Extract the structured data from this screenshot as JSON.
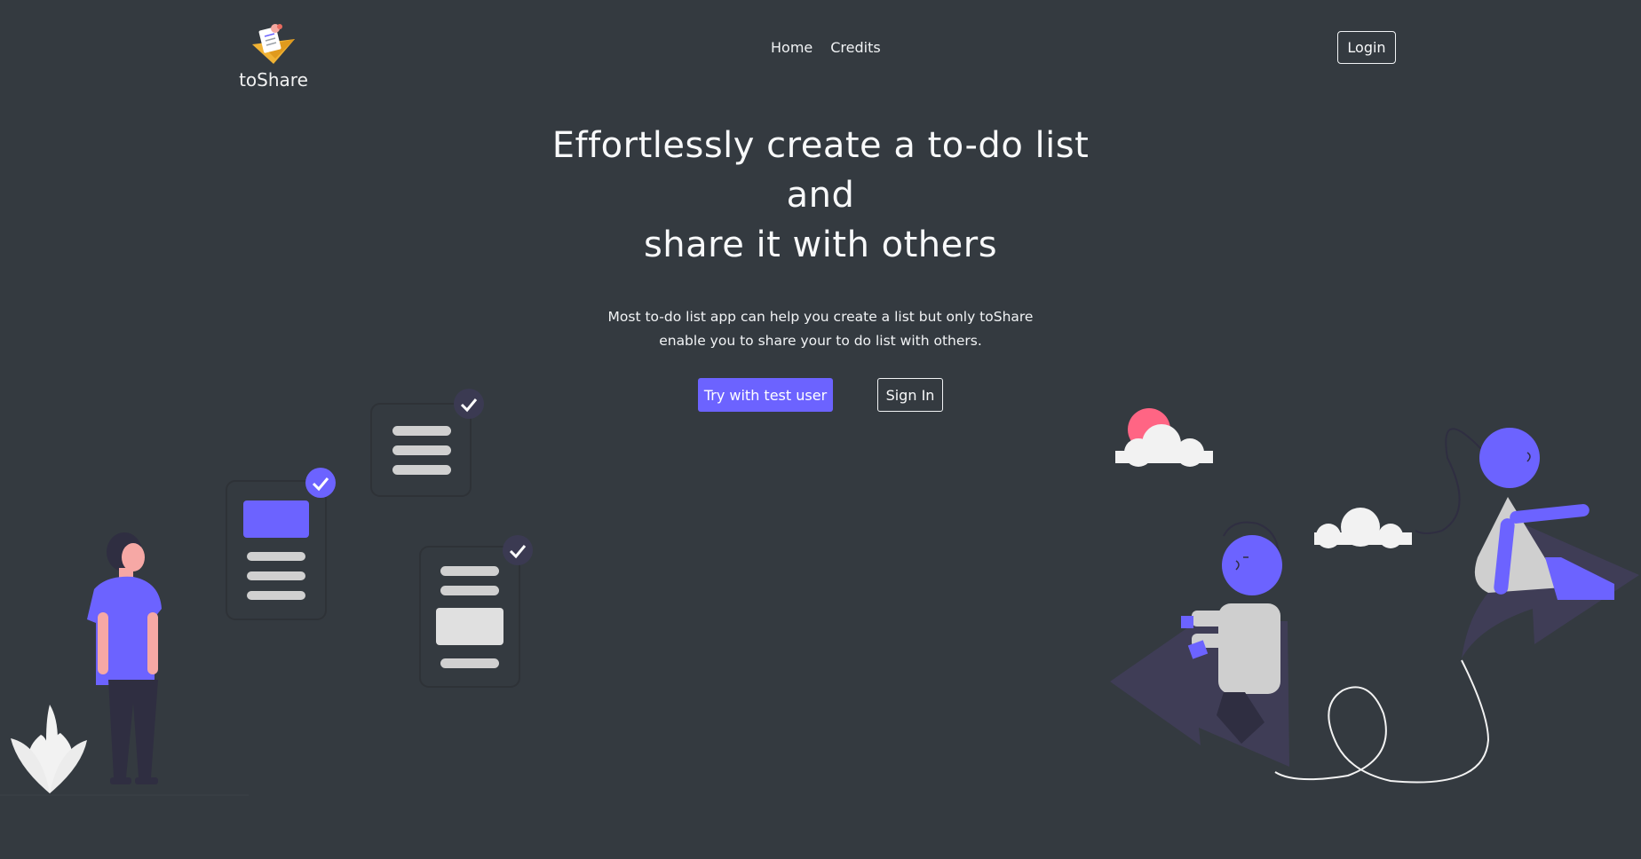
{
  "brand": {
    "name": "toShare",
    "logo_icon": "paper-plane-checklist-icon"
  },
  "nav": {
    "items": [
      {
        "label": "Home"
      },
      {
        "label": "Credits"
      }
    ],
    "login_label": "Login"
  },
  "hero": {
    "title_lines": [
      "Effortlessly create a to-do list",
      "and",
      "share it with others"
    ],
    "subtitle_lines": [
      "Most to-do list app can help you create a list but only toShare",
      "enable you to share your to do list with others."
    ],
    "primary_button": "Try with test user",
    "secondary_button": "Sign In"
  },
  "colors": {
    "background": "#343a40",
    "accent": "#6c63ff",
    "text": "#f8f9fa"
  },
  "illustrations": {
    "left": "person-with-checklists-illustration",
    "right": "people-riding-arrows-illustration"
  }
}
